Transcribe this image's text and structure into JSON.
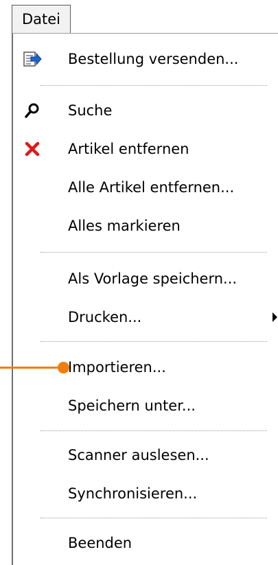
{
  "menubar": {
    "title": "Datei"
  },
  "menu": {
    "items": [
      {
        "label": "Bestellung versenden...",
        "icon": "send-document-icon"
      },
      {
        "label": "Suche",
        "icon": "search-icon"
      },
      {
        "label": "Artikel entfernen",
        "icon": "delete-x-icon",
        "icon_color": "#e01818"
      },
      {
        "label": "Alle Artikel entfernen..."
      },
      {
        "label": "Alles markieren"
      },
      {
        "label": "Als Vorlage speichern..."
      },
      {
        "label": "Drucken...",
        "submenu": true
      },
      {
        "label": "Importieren..."
      },
      {
        "label": "Speichern unter..."
      },
      {
        "label": "Scanner auslesen..."
      },
      {
        "label": "Synchronisieren..."
      },
      {
        "label": "Beenden"
      }
    ]
  },
  "highlight_color": "#f07d0f"
}
